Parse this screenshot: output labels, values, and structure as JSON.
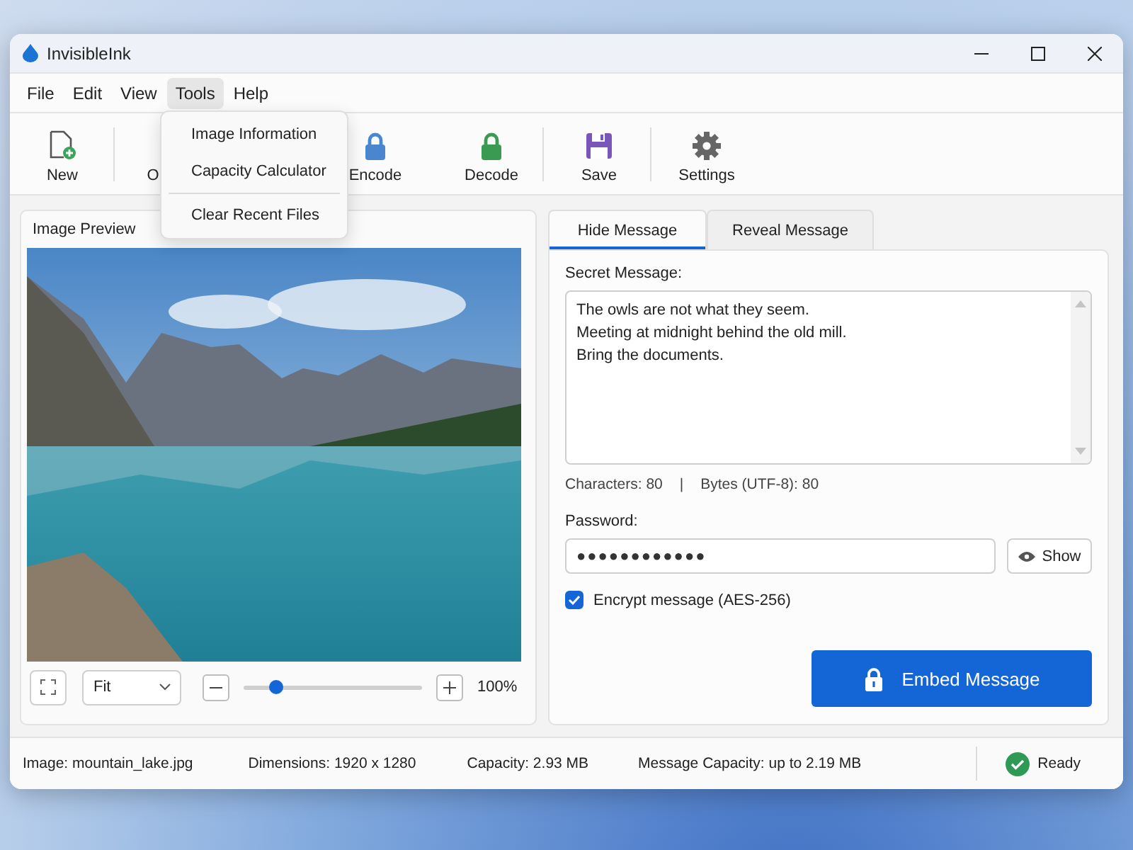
{
  "window": {
    "title": "InvisibleInk"
  },
  "menu_bar": [
    {
      "label": "File",
      "selected": false
    },
    {
      "label": "Edit",
      "selected": false
    },
    {
      "label": "View",
      "selected": false
    },
    {
      "label": "Tools",
      "selected": true
    },
    {
      "label": "Help",
      "selected": false
    }
  ],
  "open_menu": {
    "items": [
      {
        "label": "Image Information",
        "divider_before": false
      },
      {
        "label": "Capacity Calculator",
        "divider_before": false
      },
      {
        "label": "Clear Recent Files",
        "divider_before": true
      }
    ]
  },
  "toolbar": {
    "groups": [
      [
        {
          "label": "New",
          "kind": "new"
        }
      ],
      [
        {
          "label": "O",
          "kind": "hidden"
        },
        {
          "label": "Encode",
          "kind": "lock-blue"
        },
        {
          "label": "Decode",
          "kind": "lock-green"
        }
      ],
      [
        {
          "label": "Save",
          "kind": "save"
        }
      ],
      [
        {
          "label": "Settings",
          "kind": "settings"
        }
      ]
    ]
  },
  "image_preview": {
    "title": "Image Preview",
    "fit": "Fit",
    "zoom": {
      "level": 0.18,
      "reading": "100%"
    }
  },
  "tabs": [
    {
      "label": "Hide Message",
      "selected": true
    },
    {
      "label": "Reveal Message",
      "selected": false
    }
  ],
  "secret_message": {
    "label": "Secret Message:",
    "value": "The owls are not what they seem.\nMeeting at midnight behind the old mill.\nBring the documents."
  },
  "counts": {
    "characters_label": "Characters:",
    "characters": "80",
    "divider": "|",
    "bytes_label": "Bytes (UTF-8):",
    "bytes": "80"
  },
  "password": {
    "label": "Password:",
    "value": "●●●●●●●●●●●●",
    "show_button": "Show"
  },
  "encrypt": {
    "label": "Encrypt message (AES-256)",
    "checked": true
  },
  "embed_button": "Embed Message",
  "status_bar": {
    "items": [
      "Image: mountain_lake.jpg",
      "Dimensions: 1920 x 1280",
      "Capacity: 2.93 MB",
      "Message Capacity: up to 2.19 MB"
    ],
    "status": "Ready"
  }
}
